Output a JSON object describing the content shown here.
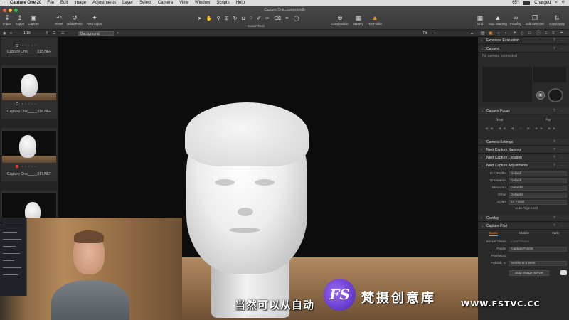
{
  "menubar": {
    "app_name": "Capture One 20",
    "items": [
      "File",
      "Edit",
      "Image",
      "Adjustments",
      "Layer",
      "Select",
      "Camera",
      "View",
      "Window",
      "Scripts",
      "Help"
    ],
    "battery": "Charged",
    "temperature": "65°"
  },
  "window": {
    "title": "Capture One.cosessiondb"
  },
  "toolbar": {
    "left_buttons": [
      "Import",
      "Export",
      "Capture"
    ],
    "mid_buttons": [
      "Reset",
      "Undo/Redo",
      "Auto Adjust"
    ],
    "cursor_tools_label": "Cursor Tools",
    "right_buttons": [
      "Composition",
      "Battery",
      "Hot Folder"
    ],
    "far_right_buttons": [
      "Grid",
      "Exp. Warning",
      "Proofing",
      "Edit Selected",
      "Copy/Apply"
    ]
  },
  "browser": {
    "counter": "1/19",
    "thumbnails": [
      {
        "caption": "Capture One_____015.NEF"
      },
      {
        "caption": "Capture One_____016.NEF"
      },
      {
        "caption": "Capture One_____017.NEF"
      }
    ]
  },
  "viewer": {
    "layer": "Background",
    "fit_label": "Fit",
    "caption": "Capture One_____020.NEF"
  },
  "tools": {
    "sections": {
      "exposure_evaluation": "Exposure Evaluation",
      "camera": "Camera",
      "camera_status": "No camera connected",
      "camera_focus": "Camera Focus",
      "focus_near": "Near",
      "focus_far": "Far",
      "camera_settings": "Camera Settings",
      "next_capture_naming": "Next Capture Naming",
      "next_capture_location": "Next Capture Location",
      "next_capture_adjustments": "Next Capture Adjustments",
      "overlay": "Overlay",
      "capture_pilot": "Capture Pilot"
    },
    "adjustments": [
      {
        "label": "ICC Profile",
        "value": "Default"
      },
      {
        "label": "Orientation",
        "value": "Default"
      },
      {
        "label": "Metadata",
        "value": "Defaults"
      },
      {
        "label": "Other",
        "value": "Defaults"
      },
      {
        "label": "Styles",
        "value": "24 Fossil"
      }
    ],
    "auto_alignment": "Auto Alignment",
    "pilot_tabs": [
      "Basic",
      "Mobile",
      "Web"
    ],
    "pilot_rows": [
      {
        "label": "Server Name",
        "value": "LiveClasses"
      },
      {
        "label": "Folder",
        "value": "Capture Folder"
      },
      {
        "label": "Password",
        "value": ""
      },
      {
        "label": "Publish To",
        "value": "Mobile and Web"
      }
    ],
    "stop_server": "Stop Image Server"
  },
  "subtitle": "当然可以从自动",
  "watermark": {
    "logo": "FS",
    "brand": "梵摄创意库",
    "site": "WWW.FSTVC.CC"
  }
}
